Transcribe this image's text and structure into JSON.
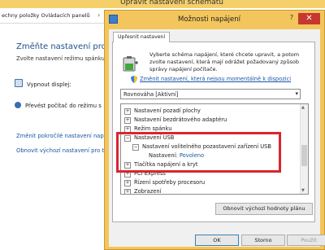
{
  "background_window": {
    "title": "Upravit nastavení schématu",
    "address_path": "echny položky Ovládacích panelů",
    "heading": "Změňte nastavení pro sc",
    "subtitle": "Zvolte nastavení režimu spánku",
    "rows": [
      {
        "label": "Vypnout displej:",
        "icon": "monitor-icon"
      },
      {
        "label": "Převést počítač do režimu s",
        "icon": "moon-icon"
      }
    ],
    "links": [
      "Změnit pokročilé nastavení napájení",
      "Obnovit výchozí nastavení pro t"
    ]
  },
  "dialog": {
    "title": "Možnosti napájení",
    "close_glyph": "✕",
    "help_glyph": "?",
    "tab": "Upřesnit nastavení",
    "description": "Vyberte schéma napájení, které chcete upravit, a potom zvolte nastavení, která mají odrážet požadovaný způsob správy napájení počítače.",
    "change_link": "Změnit nastavení, která nejsou momentálně k dispozici",
    "plan": "Rovnováha [Aktivní]",
    "tree": [
      {
        "label": "Nastavení pozadí plochy",
        "level": 0,
        "toggle": "+"
      },
      {
        "label": "Nastavení bezdrátového adaptéru",
        "level": 0,
        "toggle": "+"
      },
      {
        "label": "Režim spánku",
        "level": 0,
        "toggle": "+"
      },
      {
        "label": "Nastavení USB",
        "level": 0,
        "toggle": "−"
      },
      {
        "label": "Nastavení volitelného pozastavení zařízení USB",
        "level": 1,
        "toggle": "−"
      },
      {
        "label": "Nastavení:",
        "value": "Povoleno",
        "level": 2,
        "toggle": ""
      },
      {
        "label": "Tlačítka napájení a kryt",
        "level": 0,
        "toggle": "+"
      },
      {
        "label": "PCI Express",
        "level": 0,
        "toggle": "+"
      },
      {
        "label": "Řízení spotřeby procesoru",
        "level": 0,
        "toggle": "+"
      },
      {
        "label": "Zobrazení",
        "level": 0,
        "toggle": "+"
      }
    ],
    "restore_button": "Obnovit výchozí hodnoty plánu",
    "ok_button": "OK",
    "cancel_button": "Storno",
    "apply_button": "Použít"
  },
  "colors": {
    "titlebar_accent": "#f3c55d",
    "link": "#1a55a3",
    "highlight": "#d9262e",
    "value": "#1a55a3"
  }
}
